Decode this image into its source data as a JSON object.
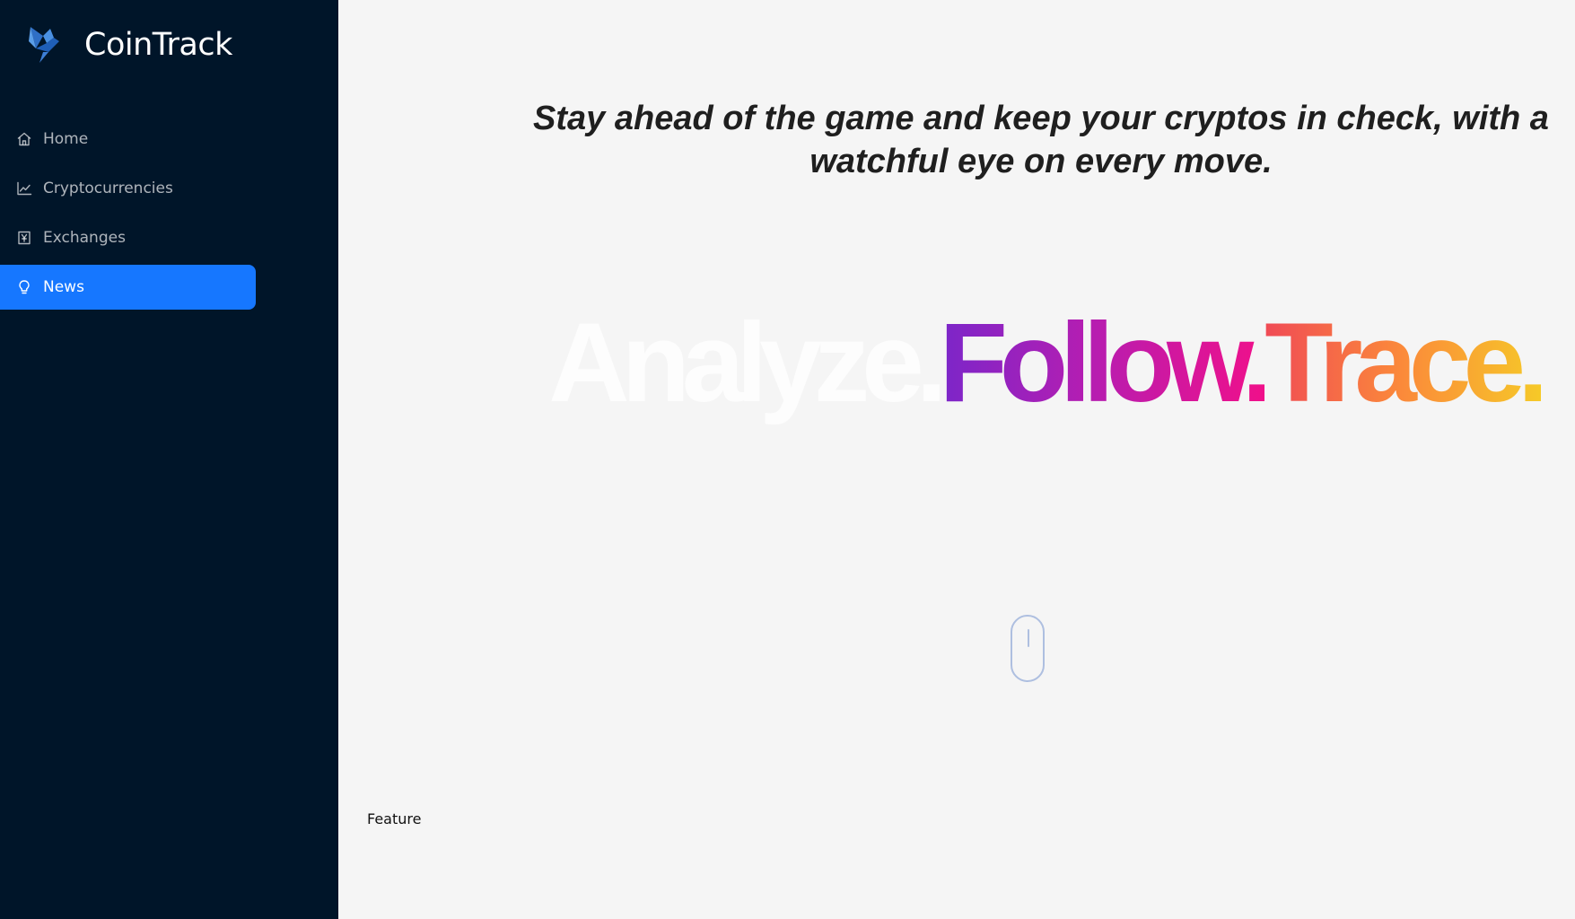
{
  "brand": {
    "name": "CoinTrack",
    "logo_icon": "bird-logo-icon"
  },
  "sidebar": {
    "items": [
      {
        "label": "Home",
        "icon": "home-icon",
        "active": false
      },
      {
        "label": "Cryptocurrencies",
        "icon": "line-chart-icon",
        "active": false
      },
      {
        "label": "Exchanges",
        "icon": "yen-box-icon",
        "active": false
      },
      {
        "label": "News",
        "icon": "bulb-icon",
        "active": true
      }
    ]
  },
  "main": {
    "tagline": "Stay ahead of the game and keep your cryptos in check, with a watchful eye on every move.",
    "hero": {
      "word1": "Analyze.",
      "word2": "Follow.",
      "word3": "Trace."
    },
    "scroll_indicator_icon": "mouse-scroll-icon",
    "feature_label": "Feature"
  },
  "colors": {
    "sidebar_bg": "#001529",
    "active_item": "#1677ff",
    "page_bg": "#f5f5f5",
    "follow_gradient": [
      "#7b26c9",
      "#f0108a"
    ],
    "trace_gradient": [
      "#f04a55",
      "#f6c928"
    ]
  }
}
